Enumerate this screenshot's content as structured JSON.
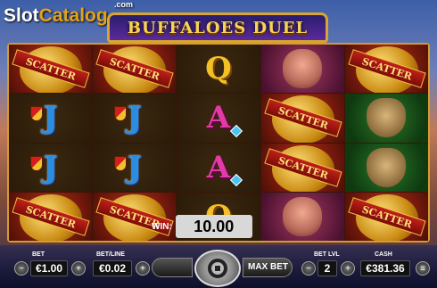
{
  "header": {
    "logo_part1": "Slot",
    "logo_part2": "Catalog",
    "logo_suffix": ".com",
    "game_title": "BUFFALOES DUEL"
  },
  "reels": [
    [
      {
        "symbol": "scatter",
        "label": "SCATTER"
      },
      {
        "symbol": "scatter",
        "label": "SCATTER"
      },
      {
        "symbol": "Q",
        "label": "Q"
      },
      {
        "symbol": "puma",
        "label": ""
      },
      {
        "symbol": "scatter",
        "label": "SCATTER"
      }
    ],
    [
      {
        "symbol": "J",
        "label": "J"
      },
      {
        "symbol": "J",
        "label": "J"
      },
      {
        "symbol": "A",
        "label": "A"
      },
      {
        "symbol": "scatter",
        "label": "SCATTER"
      },
      {
        "symbol": "hare",
        "label": ""
      }
    ],
    [
      {
        "symbol": "J",
        "label": "J"
      },
      {
        "symbol": "J",
        "label": "J"
      },
      {
        "symbol": "A",
        "label": "A"
      },
      {
        "symbol": "scatter",
        "label": ""
      },
      {
        "symbol": "hare",
        "label": ""
      }
    ],
    [
      {
        "symbol": "scatter",
        "label": "SCATTER"
      },
      {
        "symbol": "scatter",
        "label": "SCATTER"
      },
      {
        "symbol": "Q",
        "label": "Q"
      },
      {
        "symbol": "puma",
        "label": ""
      },
      {
        "symbol": "scatter",
        "label": "SCATTER"
      }
    ]
  ],
  "win": {
    "label": "WIN:",
    "value": "10.00"
  },
  "controls": {
    "bet_label": "BET",
    "bet_value": "€1.00",
    "betline_label": "BET/LINE",
    "betline_value": "€0.02",
    "maxbet_label": "MAX BET",
    "betlvl_label": "BET LVL",
    "betlvl_value": "2",
    "cash_label": "CASH",
    "cash_value": "€381.36"
  },
  "colors": {
    "frame": "#d69b2e",
    "reel_bg": "#7a1a0d",
    "title": "#f6d35a"
  }
}
